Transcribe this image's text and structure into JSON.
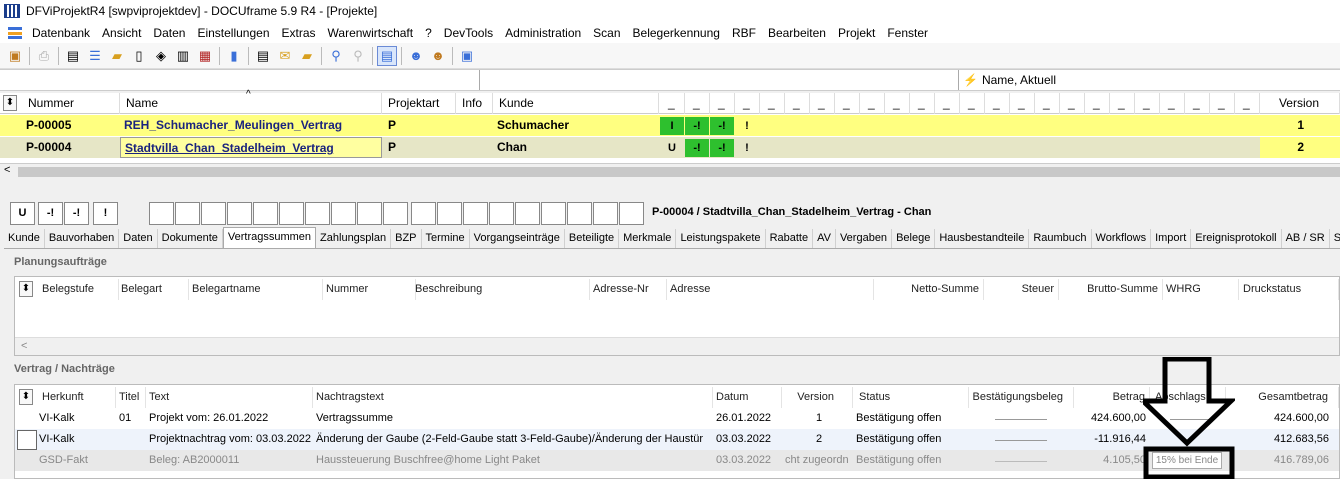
{
  "window": {
    "title": "DFViProjektR4 [swpviprojektdev] - DOCUframe 5.9 R4 - [Projekte]"
  },
  "menu": [
    "Datenbank",
    "Ansicht",
    "Daten",
    "Einstellungen",
    "Extras",
    "Warenwirtschaft",
    "?",
    "DevTools",
    "Administration",
    "Scan",
    "Belegerkennung",
    "RBF",
    "Bearbeiten",
    "Projekt",
    "Fenster"
  ],
  "filter": {
    "sort_label": "Name, Aktuell"
  },
  "projects": {
    "headers": {
      "nummer": "Nummer",
      "name": "Name",
      "projektart": "Projektart",
      "info": "Info",
      "kunde": "Kunde",
      "version": "Version",
      "dash": "_"
    },
    "rows": [
      {
        "nummer": "P-00005",
        "name": "REH_Schumacher_Meulingen_Vertrag",
        "projektart": "P",
        "kunde": "Schumacher",
        "s1": "I",
        "s2": "-!",
        "s3": "-!",
        "s4": "!",
        "version": "1"
      },
      {
        "nummer": "P-00004",
        "name": "Stadtvilla_Chan_Stadelheim_Vertrag",
        "projektart": "P",
        "kunde": "Chan",
        "s1": "U",
        "s2": "-!",
        "s3": "-!",
        "s4": "!",
        "version": "2"
      }
    ],
    "scroll_left": "<"
  },
  "detail": {
    "status": {
      "s1": "U",
      "s2": "-!",
      "s3": "-!",
      "s4": "!"
    },
    "caption": "P-00004 / Stadtvilla_Chan_Stadelheim_Vertrag - Chan"
  },
  "tabs": [
    "Kunde",
    "Bauvorhaben",
    "Daten",
    "Dokumente",
    "Vertragssummen",
    "Zahlungsplan",
    "BZP",
    "Termine",
    "Vorgangseinträge",
    "Beteiligte",
    "Merkmale",
    "Leistungspakete",
    "Rabatte",
    "AV",
    "Vergaben",
    "Belege",
    "Hausbestandteile",
    "Raumbuch",
    "Workflows",
    "Import",
    "Ereignisprotokoll",
    "AB / SR",
    "Suche"
  ],
  "planung": {
    "title": "Planungsaufträge",
    "headers": [
      "Belegstufe",
      "Belegart",
      "Belegartname",
      "Nummer",
      "Beschreibung",
      "Adresse-Nr",
      "Adresse",
      "Netto-Summe",
      "Steuer",
      "Brutto-Summe",
      "WHRG",
      "Druckstatus"
    ],
    "scroll_left": "<"
  },
  "vertrag": {
    "title": "Vertrag / Nachträge",
    "headers": {
      "herkunft": "Herkunft",
      "titel": "Titel",
      "text": "Text",
      "nachtragstext": "Nachtragstext",
      "datum": "Datum",
      "version": "Version",
      "status": "Status",
      "beleg": "Bestätigungsbeleg",
      "betrag": "Betrag",
      "abschlag": "Abschlags",
      "gesamt": "Gesamtbetrag"
    },
    "rows": [
      {
        "herkunft": "VI-Kalk",
        "titel": "01",
        "text": "Projekt vom: 26.01.2022",
        "nachtragstext": "Vertragssumme",
        "datum": "26.01.2022",
        "version": "1",
        "status": "Bestätigung offen",
        "betrag": "424.600,00",
        "gesamt": "424.600,00"
      },
      {
        "herkunft": "VI-Kalk",
        "titel": "",
        "text": "Projektnachtrag vom: 03.03.2022",
        "nachtragstext": "Änderung der Gaube (2-Feld-Gaube statt 3-Feld-Gaube)/Änderung der Haustür",
        "datum": "03.03.2022",
        "version": "2",
        "status": "Bestätigung offen",
        "betrag": "-11.916,44",
        "gesamt": "412.683,56"
      },
      {
        "herkunft": "GSD-Fakt",
        "titel": "",
        "text": "Beleg: AB2000011",
        "nachtragstext": "Haussteuerung Buschfree@home Light Paket",
        "datum": "03.03.2022",
        "version": "cht zugeordn",
        "status": "Bestätigung offen",
        "betrag": "4.105,50",
        "abschlag": "15% bei Ende",
        "gesamt": "416.789,06"
      }
    ]
  }
}
